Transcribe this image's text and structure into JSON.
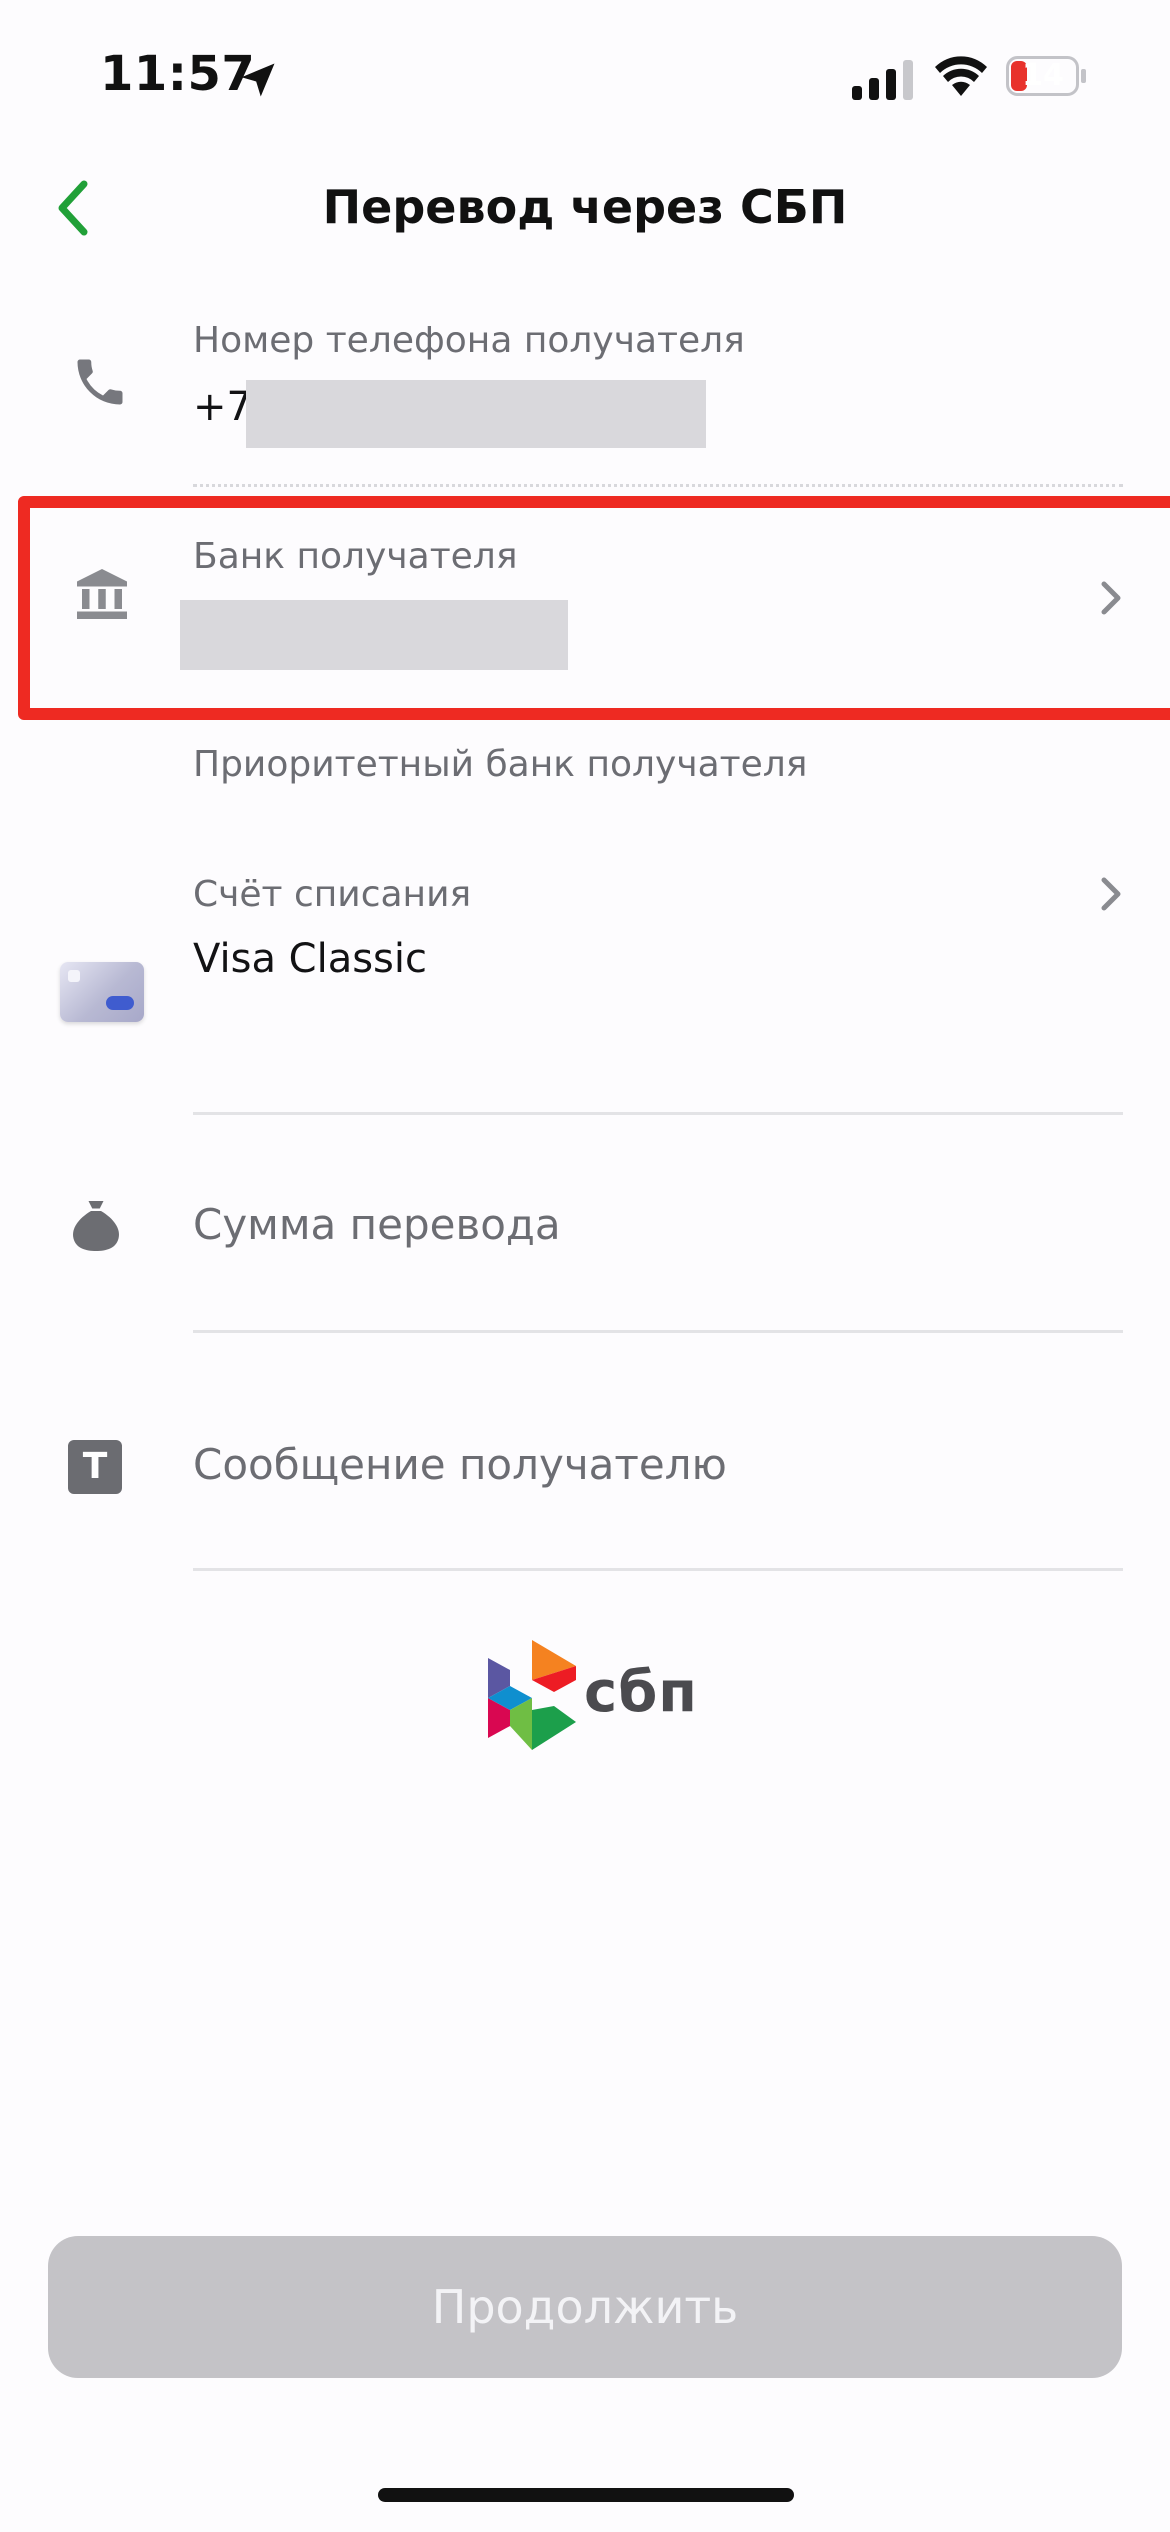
{
  "status_bar": {
    "time": "11:57",
    "battery_level": "14",
    "battery_color": "#e8322c",
    "icons": [
      "location-arrow-icon",
      "cellular-signal-icon",
      "wifi-icon",
      "battery-icon"
    ]
  },
  "nav": {
    "title": "Перевод через СБП",
    "back_icon": "chevron-left-icon",
    "accent_color": "#21a038"
  },
  "form": {
    "phone": {
      "icon": "phone-icon",
      "label": "Номер телефона получателя",
      "prefix": "+7"
    },
    "bank": {
      "icon": "bank-icon",
      "label": "Банк получателя",
      "hint": "Приоритетный банк получателя",
      "highlight_color": "#ee2a22"
    },
    "account": {
      "icon": "card-icon",
      "label": "Счёт списания",
      "value": "Visa Classic"
    },
    "amount": {
      "icon": "money-bag-icon",
      "placeholder": "Сумма перевода"
    },
    "message": {
      "icon": "text-t-icon",
      "placeholder": "Сообщение получателю"
    }
  },
  "logo": {
    "text": "сбп",
    "icon": "sbp-logo-icon"
  },
  "continue_button": {
    "label": "Продолжить",
    "enabled": false
  }
}
